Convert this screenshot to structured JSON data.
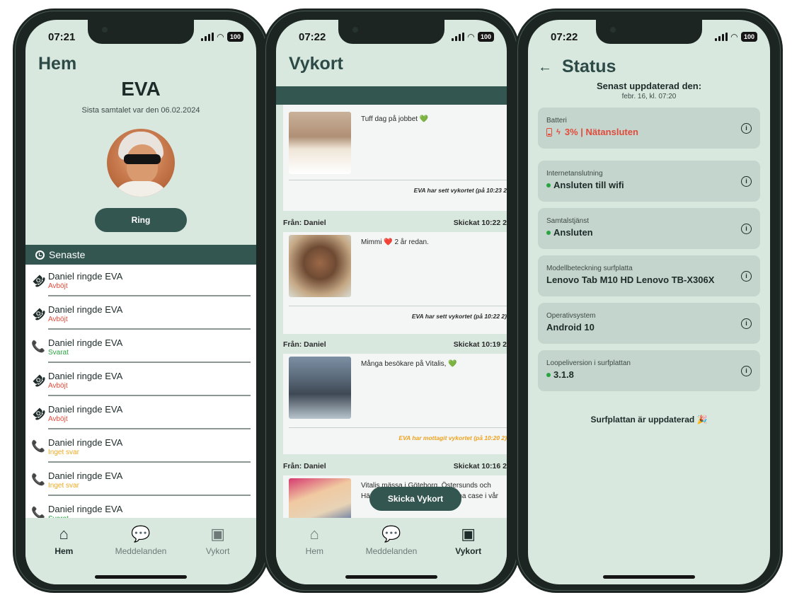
{
  "phone1": {
    "time": "07:21",
    "battery": "100",
    "title": "Hem",
    "user_name": "EVA",
    "last_call": "Sista samtalet var den 06.02.2024",
    "call_button": "Ring",
    "recent_label": "Senaste",
    "calls": [
      {
        "title": "Daniel ringde EVA",
        "status": "Avböjt",
        "kind": "rejected"
      },
      {
        "title": "Daniel ringde EVA",
        "status": "Avböjt",
        "kind": "rejected"
      },
      {
        "title": "Daniel ringde EVA",
        "status": "Svarat",
        "kind": "answered"
      },
      {
        "title": "Daniel ringde EVA",
        "status": "Avböjt",
        "kind": "rejected"
      },
      {
        "title": "Daniel ringde EVA",
        "status": "Avböjt",
        "kind": "rejected"
      },
      {
        "title": "Daniel ringde EVA",
        "status": "Inget svar",
        "kind": "noanswer"
      },
      {
        "title": "Daniel ringde EVA",
        "status": "Inget svar",
        "kind": "noanswer"
      },
      {
        "title": "Daniel ringde EVA",
        "status": "Svarat",
        "kind": "answered"
      }
    ],
    "nav": [
      {
        "label": "Hem",
        "icon": "home-icon"
      },
      {
        "label": "Meddelanden",
        "icon": "chat-bubble-icon"
      },
      {
        "label": "Vykort",
        "icon": "image-icon"
      }
    ]
  },
  "phone2": {
    "time": "07:22",
    "battery": "100",
    "title": "Vykort",
    "postcards": [
      {
        "from": "",
        "sent": "",
        "message": "Tuff dag på jobbet 💚",
        "seen": "EVA har sett vykortet (på 10:23 2"
      },
      {
        "from": "Från: Daniel",
        "sent": "Skickat 10:22 2",
        "message": "Mimmi ❤️ 2 år redan.",
        "seen": "EVA har sett vykortet (på 10:22 2)"
      },
      {
        "from": "Från: Daniel",
        "sent": "Skickat 10:19 2",
        "message": "Många besökare på Vitalis, 💚",
        "seen": "EVA har mottagit vykortet (på 10:20 2)"
      },
      {
        "from": "Från: Daniel",
        "sent": "Skickat 10:16 2",
        "message": "Vitalis mässa i Göteborg. Östersunds och Härryda kommun berätta om sina case i vår",
        "seen": ""
      }
    ],
    "send_button": "Skicka Vykort",
    "nav": [
      {
        "label": "Hem",
        "icon": "home-icon"
      },
      {
        "label": "Meddelanden",
        "icon": "chat-bubble-icon"
      },
      {
        "label": "Vykort",
        "icon": "image-icon"
      }
    ]
  },
  "phone3": {
    "time": "07:22",
    "battery": "100",
    "title": "Status",
    "updated_label": "Senast uppdaterad den:",
    "updated_date": "febr. 16, kl. 07:20",
    "cards": [
      {
        "label": "Batteri",
        "value": "3% | Nätansluten"
      },
      {
        "label": "Internetanslutning",
        "value": "Ansluten till wifi"
      },
      {
        "label": "Samtalstjänst",
        "value": "Ansluten"
      },
      {
        "label": "Modellbeteckning surfplatta",
        "value": "Lenovo Tab M10 HD Lenovo TB-X306X"
      },
      {
        "label": "Operativsystem",
        "value": "Android 10"
      },
      {
        "label": "Loopeliversion i surfplattan",
        "value": "3.1.8"
      }
    ],
    "up_to_date": "Surfplattan är uppdaterad 🎉"
  },
  "colors": {
    "background": "#d8e8df",
    "primary": "#345650",
    "title": "#2d4a46",
    "rejected": "#e24a3b",
    "answered": "#2aa443",
    "no_answer": "#eeaa22"
  }
}
